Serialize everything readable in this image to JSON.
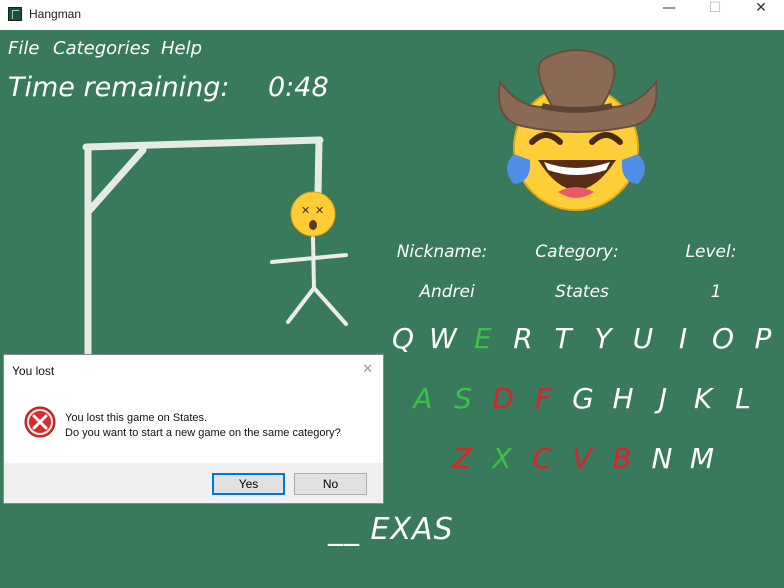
{
  "window": {
    "title": "Hangman",
    "minimize": "—",
    "maximize": "☐",
    "close": "✕"
  },
  "menu": {
    "file": "File",
    "categories": "Categories",
    "help": "Help"
  },
  "timer": {
    "label": "Time remaining:",
    "value": "0:48"
  },
  "info": {
    "nickname_label": "Nickname:",
    "category_label": "Category:",
    "level_label": "Level:",
    "nickname": "Andrei",
    "category": "States",
    "level": "1"
  },
  "keyboard": {
    "row1": [
      "Q",
      "W",
      "E",
      "R",
      "T",
      "Y",
      "U",
      "I",
      "O",
      "P"
    ],
    "row2": [
      "A",
      "S",
      "D",
      "F",
      "G",
      "H",
      "J",
      "K",
      "L"
    ],
    "row3": [
      "Z",
      "X",
      "C",
      "V",
      "B",
      "N",
      "M"
    ],
    "correct": [
      "E",
      "A",
      "S",
      "X"
    ],
    "wrong": [
      "D",
      "F",
      "Z",
      "C",
      "V",
      "B"
    ]
  },
  "word": "__ EXAS",
  "dialog": {
    "title": "You lost",
    "close": "✕",
    "message_line1": "You lost this game on States.",
    "message_line2": "Do you want to start a new game on the same category?",
    "yes": "Yes",
    "no": "No"
  },
  "colors": {
    "board": "#3a7a5c",
    "correct": "#39c24a",
    "wrong": "#d8232a"
  },
  "icons": [
    "app-icon",
    "error-icon",
    "laughing-cowboy-emoji-icon",
    "dizzy-face-emoji-icon"
  ]
}
